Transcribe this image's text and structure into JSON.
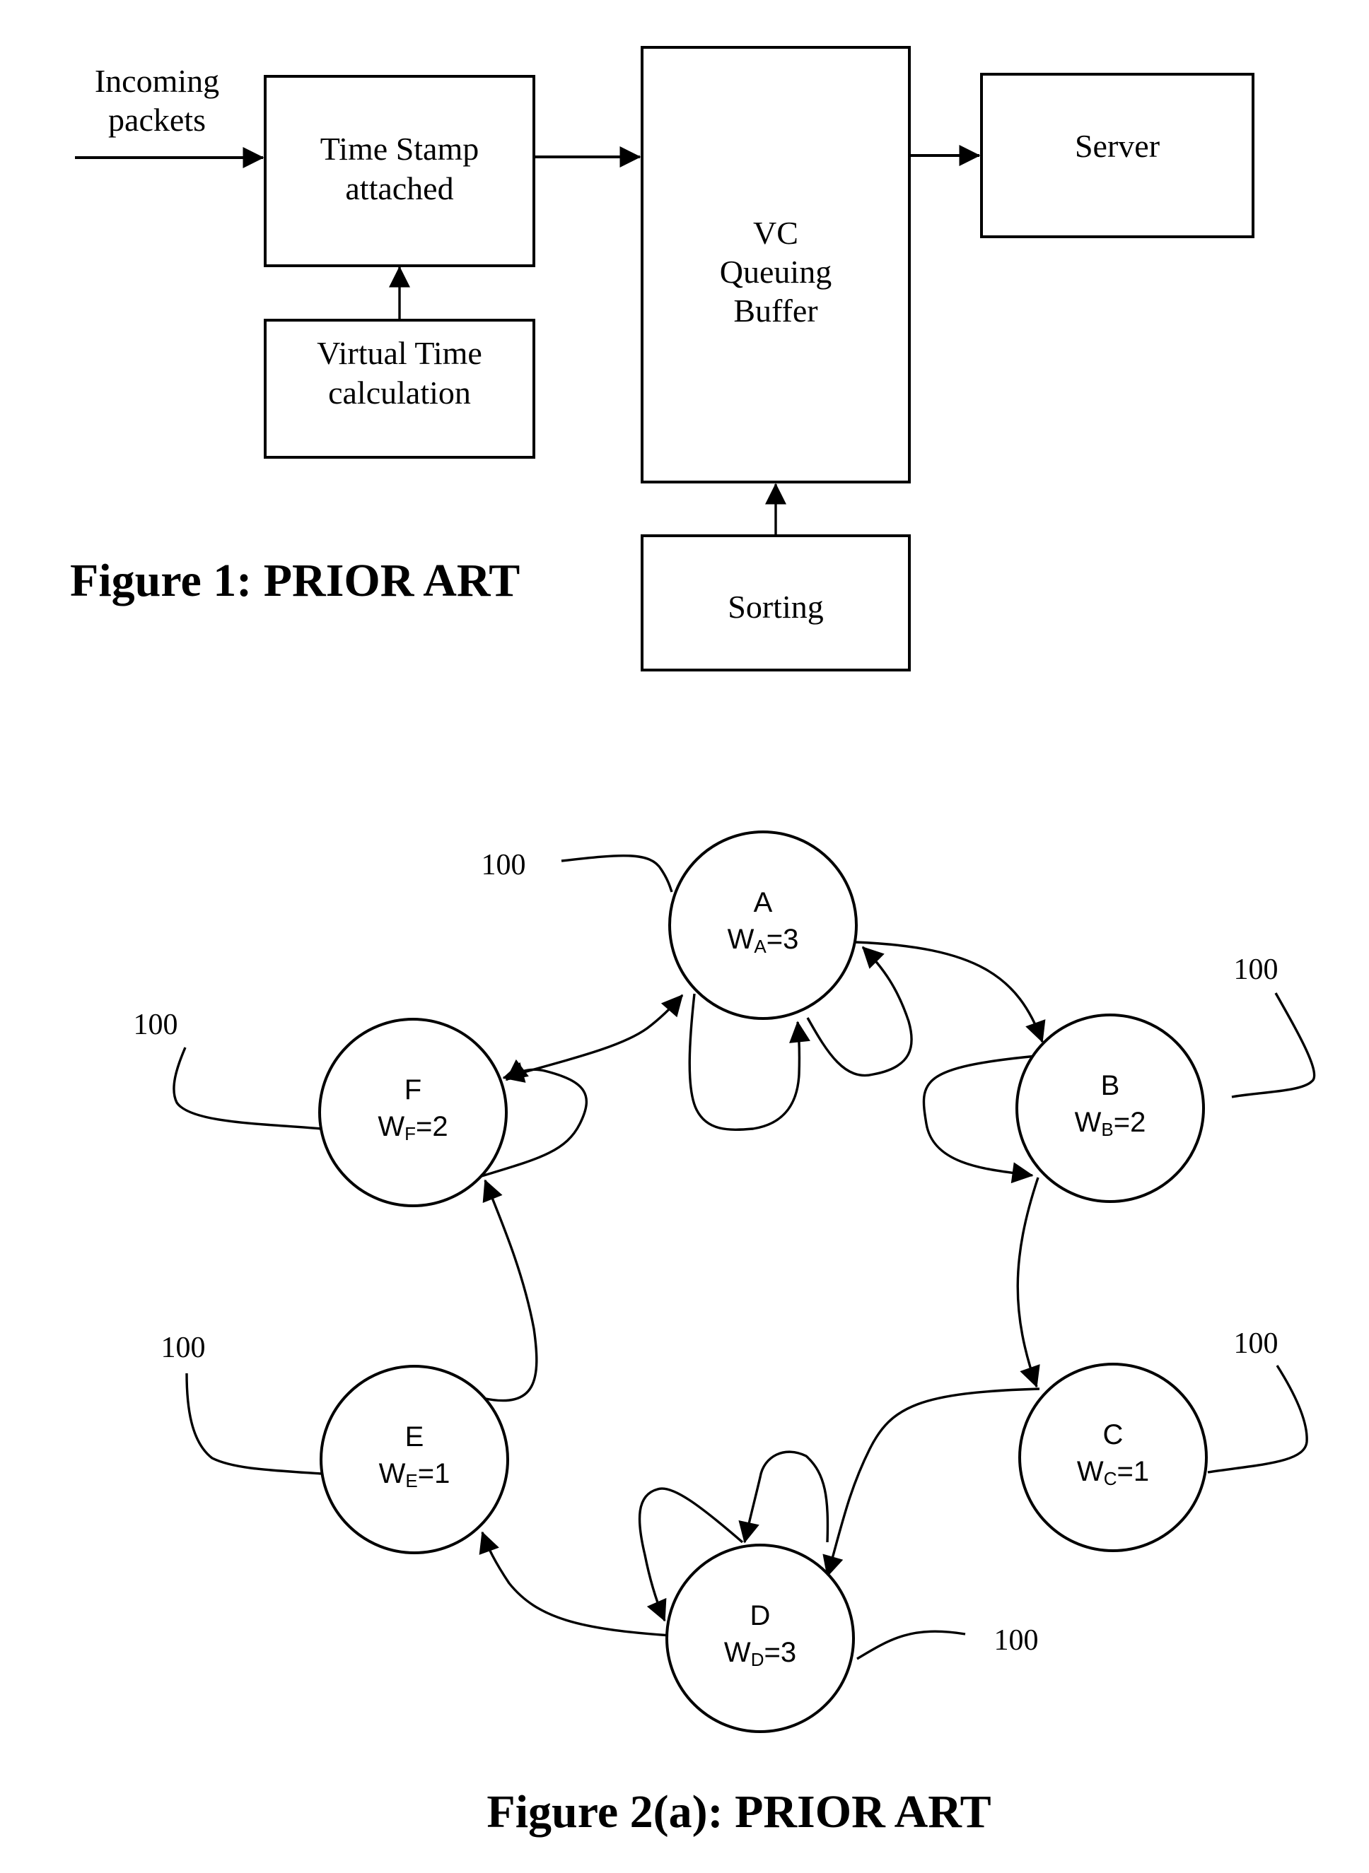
{
  "figure1": {
    "caption": "Figure 1:  PRIOR ART",
    "input_label": [
      "Incoming",
      "packets"
    ],
    "blocks": {
      "timestamp": [
        "Time Stamp",
        "attached"
      ],
      "virtual_time": [
        "Virtual Time",
        "calculation"
      ],
      "vc_buffer": [
        "VC",
        "Queuing",
        "Buffer"
      ],
      "server": [
        "Server"
      ],
      "sorting": [
        "Sorting"
      ]
    },
    "connections": [
      {
        "from": "Incoming packets",
        "to": "Time Stamp attached"
      },
      {
        "from": "Virtual Time calculation",
        "to": "Time Stamp attached"
      },
      {
        "from": "Time Stamp attached",
        "to": "VC Queuing Buffer"
      },
      {
        "from": "Sorting",
        "to": "VC Queuing Buffer"
      },
      {
        "from": "VC Queuing Buffer",
        "to": "Server"
      }
    ]
  },
  "figure2": {
    "caption": "Figure 2(a):  PRIOR ART",
    "ref_label": "100",
    "nodes": [
      {
        "id": "A",
        "weight_sym": "W",
        "weight_sub": "A",
        "weight_val": "=3"
      },
      {
        "id": "B",
        "weight_sym": "W",
        "weight_sub": "B",
        "weight_val": "=2"
      },
      {
        "id": "C",
        "weight_sym": "W",
        "weight_sub": "C",
        "weight_val": "=1"
      },
      {
        "id": "D",
        "weight_sym": "W",
        "weight_sub": "D",
        "weight_val": "=3"
      },
      {
        "id": "E",
        "weight_sym": "W",
        "weight_sub": "E",
        "weight_val": "=1"
      },
      {
        "id": "F",
        "weight_sym": "W",
        "weight_sub": "F",
        "weight_val": "=2"
      }
    ],
    "edges": [
      {
        "from": "A",
        "to": "B"
      },
      {
        "from": "B",
        "to": "B"
      },
      {
        "from": "B",
        "to": "C"
      },
      {
        "from": "C",
        "to": "D"
      },
      {
        "from": "D",
        "to": "D"
      },
      {
        "from": "D",
        "to": "D"
      },
      {
        "from": "D",
        "to": "E"
      },
      {
        "from": "E",
        "to": "F"
      },
      {
        "from": "F",
        "to": "F"
      },
      {
        "from": "F",
        "to": "A"
      },
      {
        "from": "A",
        "to": "A"
      },
      {
        "from": "A",
        "to": "A"
      }
    ]
  }
}
